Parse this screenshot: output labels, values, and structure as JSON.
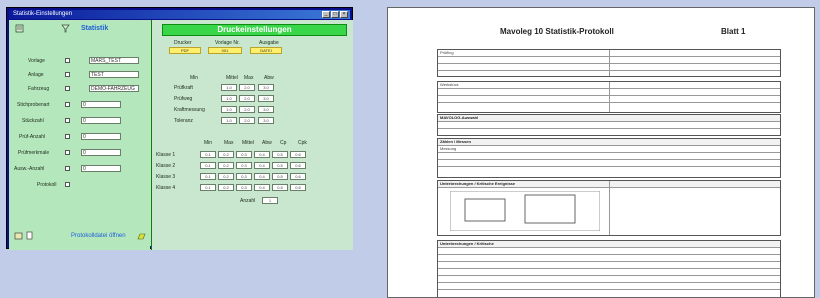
{
  "app_window": {
    "title": "Statistik-Einstellungen",
    "left_panel": {
      "header": "Statistik",
      "fields": [
        {
          "label": "Vorlage",
          "value": "MARS_TEST"
        },
        {
          "label": "Anlage",
          "value": "TEST"
        },
        {
          "label": "Fahrzeug",
          "value": "DEMO-FAHRZEUG"
        },
        {
          "label": "Stichprobenart",
          "value": "0"
        },
        {
          "label": "Stückzahl",
          "value": "0"
        },
        {
          "label": "Prüf-Anzahl",
          "value": "0"
        },
        {
          "label": "Prüfmerkmale",
          "value": "0"
        },
        {
          "label": "Ausw.-Anzahl",
          "value": "0"
        },
        {
          "label": "Protokoll",
          "value": ""
        }
      ],
      "status_label": "Protokolldatei öffnen"
    },
    "right_panel": {
      "header": "Druckeinstellungen",
      "top_columns": [
        "Drucker",
        "Vorlage Nr.",
        "Ausgabe"
      ],
      "top_values": [
        "PDF",
        "001",
        "DATEI"
      ],
      "mid_columns": [
        "Min",
        "Mittel",
        "Max",
        "Abw"
      ],
      "mid_rows": [
        {
          "label": "Prüfkraft",
          "values": [
            "1.0",
            "2.0",
            "3.0"
          ]
        },
        {
          "label": "Prüfweg",
          "values": [
            "1.0",
            "2.0",
            "3.0"
          ]
        },
        {
          "label": "Kraftmessung",
          "values": [
            "1.0",
            "2.0",
            "3.0"
          ]
        },
        {
          "label": "Toleranz",
          "values": [
            "1.0",
            "2.0",
            "3.0"
          ]
        }
      ],
      "grid_columns": [
        "Min",
        "Max",
        "Mittel",
        "Abw",
        "Cp",
        "Cpk"
      ],
      "grid_rows": [
        {
          "label": "Klasse 1",
          "values": [
            "0.1",
            "0.2",
            "0.3",
            "0.4",
            "0.5",
            "0.6"
          ]
        },
        {
          "label": "Klasse 2",
          "values": [
            "0.1",
            "0.2",
            "0.3",
            "0.4",
            "0.5",
            "0.6"
          ]
        },
        {
          "label": "Klasse 3",
          "values": [
            "0.1",
            "0.2",
            "0.3",
            "0.4",
            "0.5",
            "0.6"
          ]
        },
        {
          "label": "Klasse 4",
          "values": [
            "0.1",
            "0.2",
            "0.3",
            "0.4",
            "0.5",
            "0.6"
          ]
        }
      ],
      "summary_label": "Anzahl",
      "summary_value": "1"
    }
  },
  "document": {
    "title": "Mavoleg 10 Statistik-Protokoll",
    "sheet": "Blatt 1",
    "sections": [
      "Prüfling",
      "Werkstück",
      "Messung",
      "MAVOLOG-Auswahl",
      "Zählen / Messen",
      "Unterbrechungen / Kritische Ereignisse",
      "Unterbrechungen / Kritische"
    ]
  }
}
